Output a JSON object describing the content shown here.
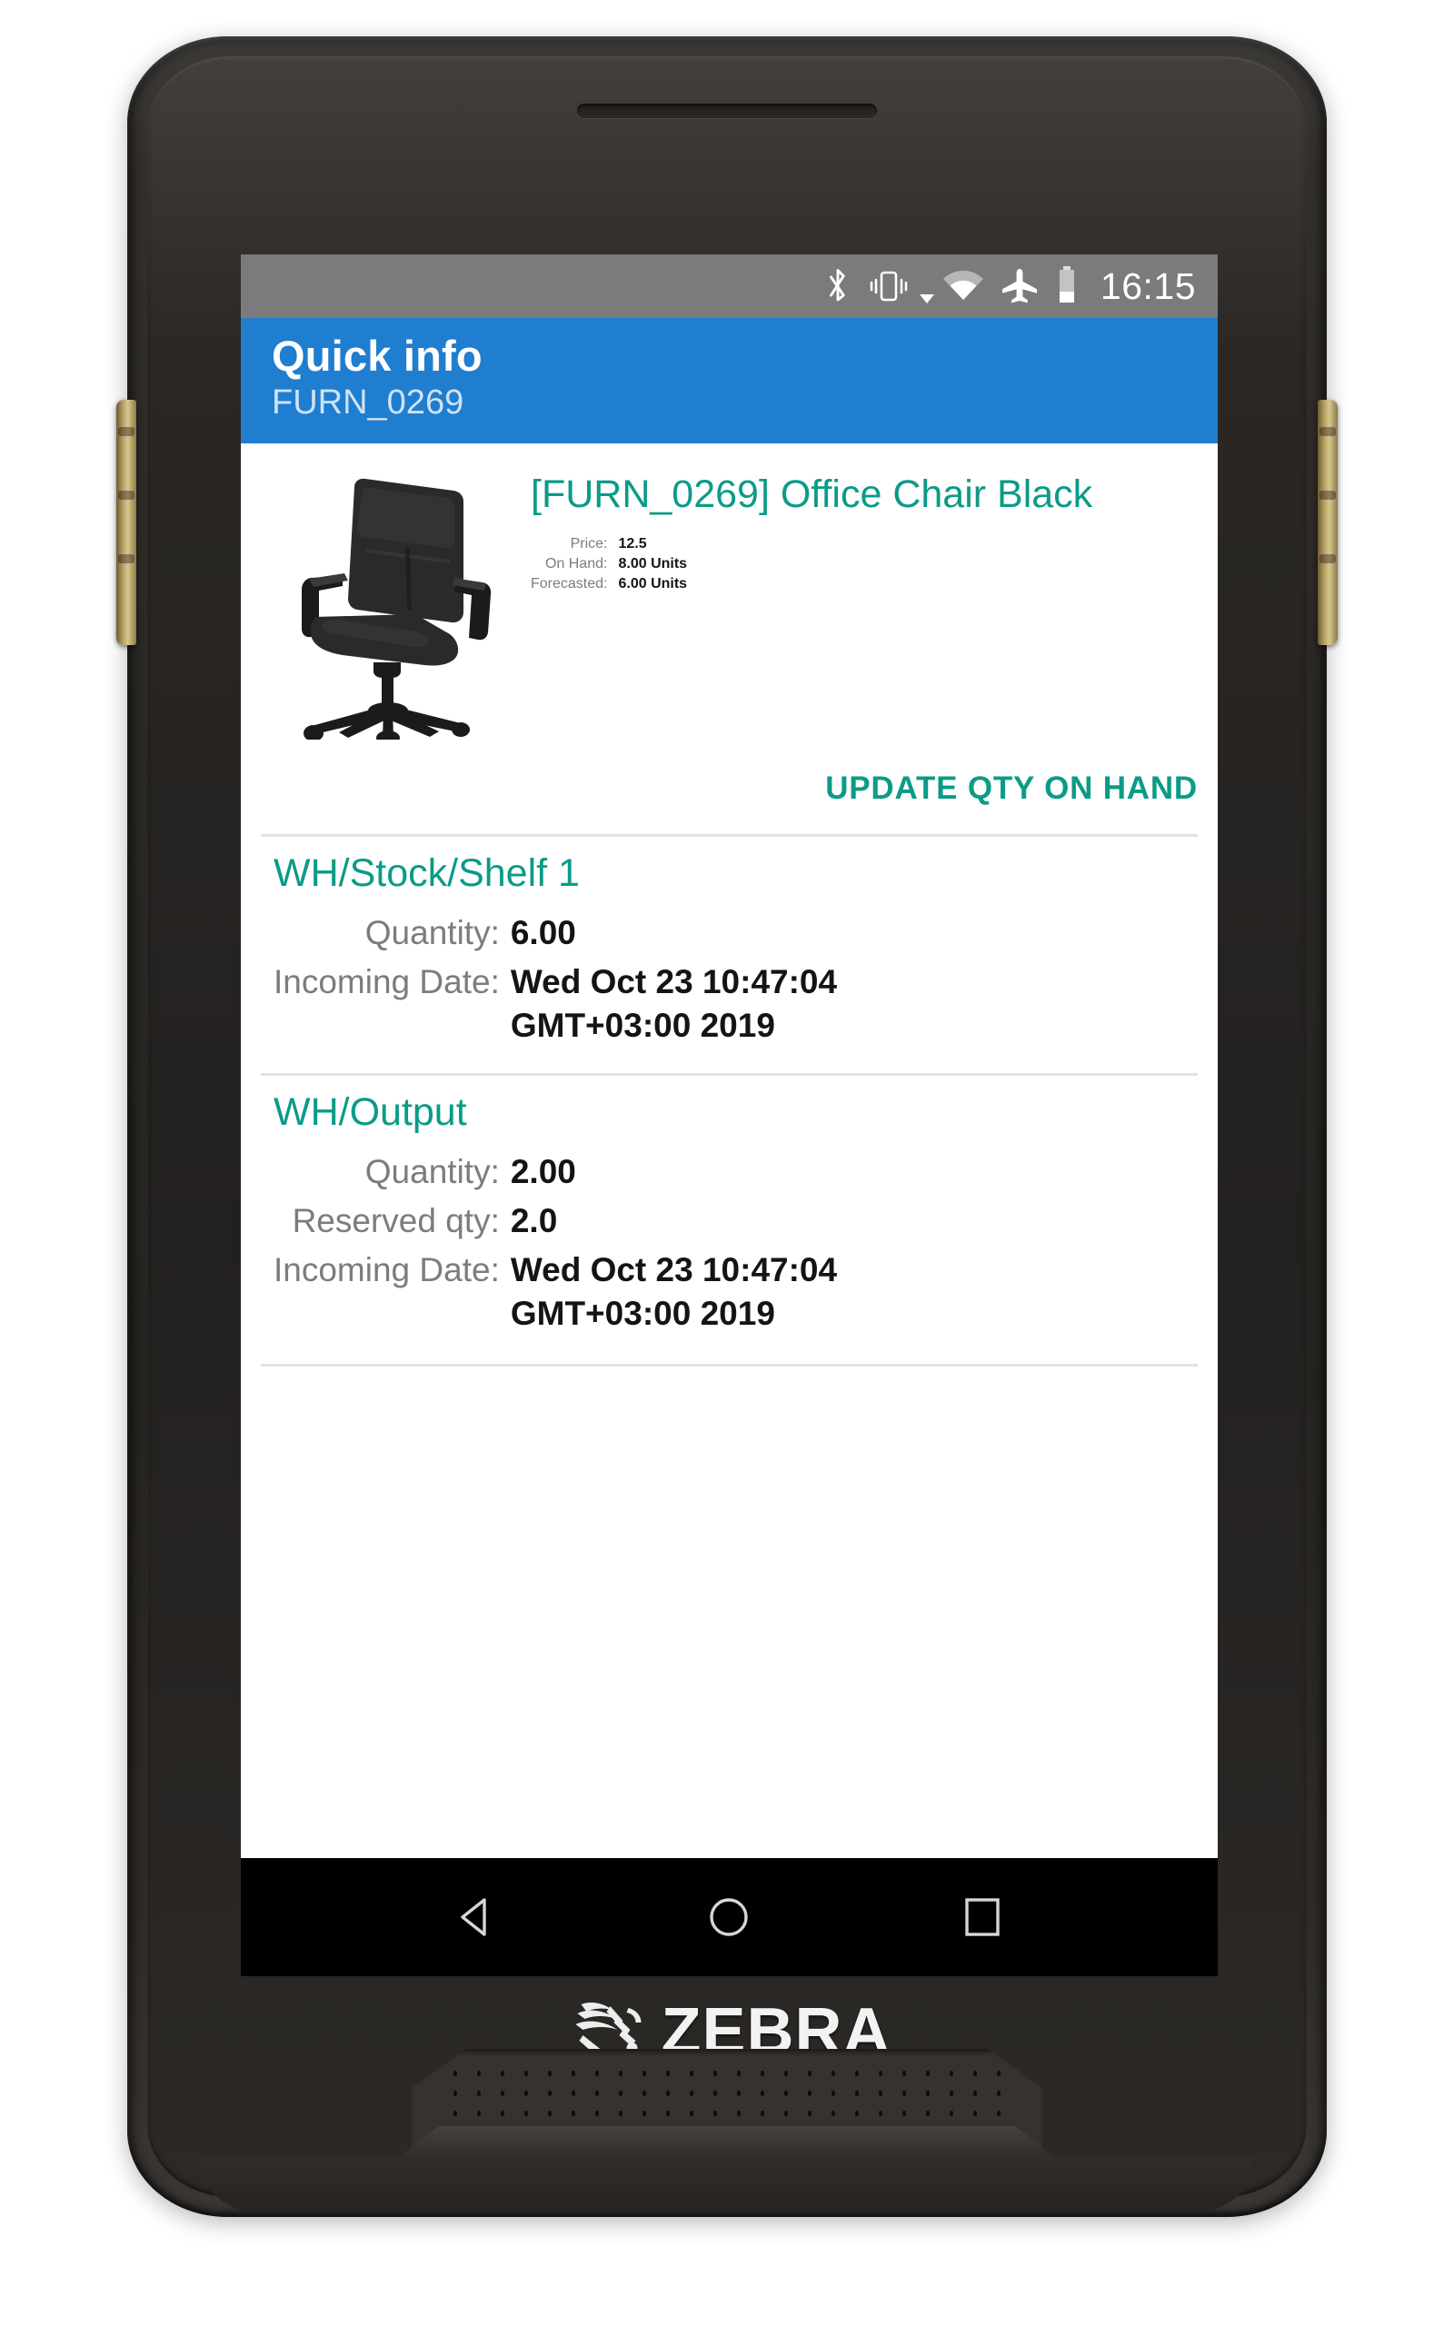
{
  "status_bar": {
    "icons": [
      "bluetooth-icon",
      "vibrate-icon",
      "dropdown-caret-icon",
      "wifi-icon",
      "airplane-mode-icon",
      "battery-icon"
    ],
    "time": "16:15"
  },
  "app_bar": {
    "title": "Quick info",
    "subtitle": "FURN_0269"
  },
  "product": {
    "image_alt": "office-chair-black",
    "title": "[FURN_0269] Office Chair Black",
    "fields": [
      {
        "label": "Price:",
        "value": "12.5"
      },
      {
        "label": "On Hand:",
        "value": "8.00 Units"
      },
      {
        "label": "Forecasted:",
        "value": "6.00 Units"
      }
    ],
    "action_label": "UPDATE QTY ON HAND"
  },
  "locations": [
    {
      "name": "WH/Stock/Shelf 1",
      "rows": [
        {
          "label": "Quantity:",
          "value": "6.00"
        },
        {
          "label": "Incoming Date:",
          "value": "Wed Oct 23 10:47:04 GMT+03:00 2019"
        }
      ]
    },
    {
      "name": "WH/Output",
      "rows": [
        {
          "label": "Quantity:",
          "value": "2.00"
        },
        {
          "label": "Reserved qty:",
          "value": "2.0"
        },
        {
          "label": "Incoming Date:",
          "value": "Wed Oct 23 10:47:04 GMT+03:00 2019"
        }
      ]
    }
  ],
  "nav_bar": {
    "back_label": "back-button",
    "home_label": "home-button",
    "recents_label": "recents-button"
  },
  "device": {
    "brand": "ZEBRA"
  },
  "colors": {
    "app_bar_blue": "#1f7ed0",
    "accent_teal": "#0b9b87",
    "status_bar_gray": "#7b7b7b",
    "label_gray": "#7c7c7c",
    "value_black": "#141414",
    "divider_gray": "#e2e2e2"
  }
}
